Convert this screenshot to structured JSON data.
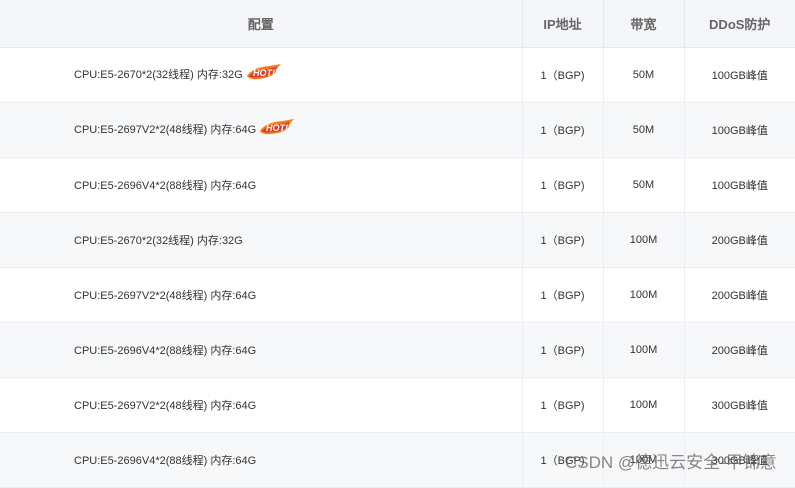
{
  "table": {
    "headers": [
      "配置",
      "IP地址",
      "带宽",
      "DDoS防护"
    ],
    "hot_badge_text": "HOT!",
    "rows": [
      {
        "config": "CPU:E5-2670*2(32线程) 内存:32G",
        "ip": "1（BGP)",
        "bandwidth": "50M",
        "ddos": "100GB峰值",
        "hot": true
      },
      {
        "config": "CPU:E5-2697V2*2(48线程) 内存:64G",
        "ip": "1（BGP)",
        "bandwidth": "50M",
        "ddos": "100GB峰值",
        "hot": true
      },
      {
        "config": "CPU:E5-2696V4*2(88线程) 内存:64G",
        "ip": "1（BGP)",
        "bandwidth": "50M",
        "ddos": "100GB峰值",
        "hot": false
      },
      {
        "config": "CPU:E5-2670*2(32线程) 内存:32G",
        "ip": "1（BGP)",
        "bandwidth": "100M",
        "ddos": "200GB峰值",
        "hot": false
      },
      {
        "config": "CPU:E5-2697V2*2(48线程) 内存:64G",
        "ip": "1（BGP)",
        "bandwidth": "100M",
        "ddos": "200GB峰值",
        "hot": false
      },
      {
        "config": "CPU:E5-2696V4*2(88线程) 内存:64G",
        "ip": "1（BGP)",
        "bandwidth": "100M",
        "ddos": "200GB峰值",
        "hot": false
      },
      {
        "config": "CPU:E5-2697V2*2(48线程) 内存:64G",
        "ip": "1（BGP)",
        "bandwidth": "100M",
        "ddos": "300GB峰值",
        "hot": false
      },
      {
        "config": "CPU:E5-2696V4*2(88线程) 内存:64G",
        "ip": "1（BGP)",
        "bandwidth": "100M",
        "ddos": "300GB峰值",
        "hot": false
      }
    ]
  },
  "watermark": "CSDN @德迅云安全-甲锦意",
  "colors": {
    "header_bg": "#f5f6f9",
    "alt_row_bg": "#f7f8fa",
    "hot_orange": "#f47a1f",
    "hot_red": "#e8381d"
  }
}
